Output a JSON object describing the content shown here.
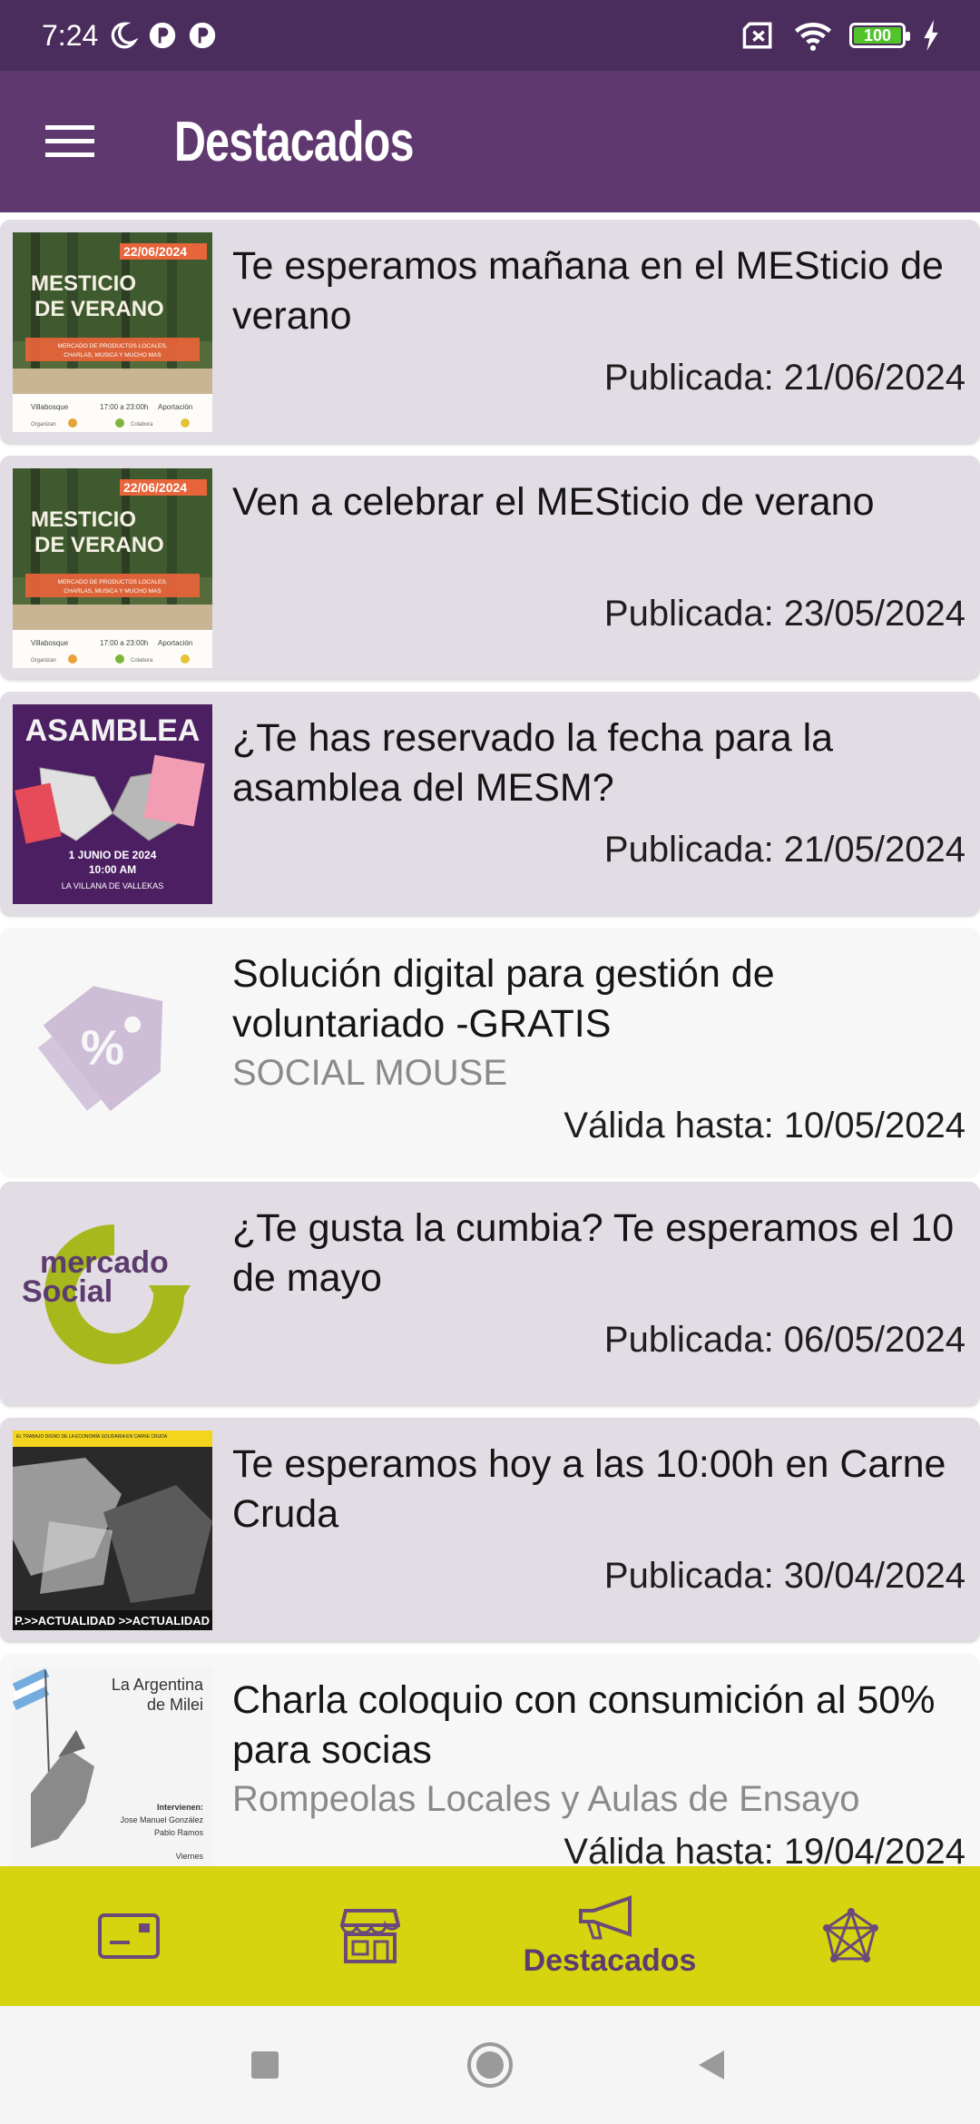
{
  "status_bar": {
    "time": "7:24",
    "battery_level": "100",
    "icons": [
      "moon-icon",
      "notification-icon",
      "notification-icon",
      "sim-off-icon",
      "wifi-icon",
      "battery-icon",
      "charging-icon"
    ]
  },
  "app_bar": {
    "title": "Destacados",
    "menu_icon": "hamburger-menu-icon"
  },
  "items": [
    {
      "kind": "publication",
      "title": "Te esperamos mañana en el MESticio de verano",
      "date_text": "Publicada: 21/06/2024",
      "thumb": {
        "heading1": "MESTICIO",
        "heading2": "DE VERANO",
        "date_tag": "22/06/2024",
        "band_text": "MERCADO DE PRODUCTOS LOCALES, CHARLAS, MUSICA Y MUCHO MAS",
        "place": "Villabosque",
        "hours": "17:00 a 23:00h",
        "fee": "Aportación",
        "footer_left": "Organizan",
        "footer_right": "Colabora"
      }
    },
    {
      "kind": "publication",
      "title": "Ven a celebrar el MESticio de verano",
      "date_text": "Publicada: 23/05/2024",
      "thumb": {
        "heading1": "MESTICIO",
        "heading2": "DE VERANO",
        "date_tag": "22/06/2024",
        "band_text": "MERCADO DE PRODUCTOS LOCALES, CHARLAS, MUSICA Y MUCHO MAS",
        "place": "Villabosque",
        "hours": "17:00 a 23:00h",
        "fee": "Aportación",
        "footer_left": "Organizan",
        "footer_right": "Colabora"
      }
    },
    {
      "kind": "publication",
      "title": "¿Te has reservado la fecha para la asamblea del MESM?",
      "date_text": "Publicada: 21/05/2024",
      "thumb": {
        "heading": "ASAMBLEA",
        "line1": "1 JUNIO DE 2024",
        "line2": "10:00 AM",
        "line3": "LA VILLANA DE VALLEKAS"
      }
    },
    {
      "kind": "offer",
      "title": "Solución digital para gestión de voluntariado -GRATIS",
      "subtitle": "SOCIAL MOUSE",
      "date_text": "Válida hasta: 10/05/2024",
      "thumb_icon": "discount-tag-icon"
    },
    {
      "kind": "publication",
      "title": "¿Te gusta la cumbia? Te esperamos el 10 de mayo",
      "date_text": "Publicada: 06/05/2024",
      "thumb": {
        "logo_word1": "mercado",
        "logo_word2": "Social"
      }
    },
    {
      "kind": "publication",
      "title": "Te esperamos hoy a las 10:00h en Carne Cruda",
      "date_text": "Publicada: 30/04/2024",
      "thumb": {
        "top_text": "EL TRABAJO DIGNO DE LA ECONOMÍA SOLIDARIA EN CARNE CRUDA",
        "bottom_text": "P.>>ACTUALIDAD >>ACTUALIDAD >>A"
      }
    },
    {
      "kind": "offer",
      "title": "Charla coloquio con consumición al 50% para socias",
      "subtitle": "Rompeolas Locales y Aulas de Ensayo",
      "date_text": "Válida hasta: 19/04/2024",
      "thumb": {
        "line1": "La Argentina",
        "line2": "de Milei",
        "speakers_label": "Intervienen:",
        "speaker1": "Jose Manuel González",
        "speaker2": "Pablo Ramos",
        "day": "Viernes"
      }
    }
  ],
  "bottom_nav": {
    "active_label": "Destacados",
    "icons": [
      "card-icon",
      "store-icon",
      "megaphone-icon",
      "network-icon"
    ]
  },
  "colors": {
    "status_bar": "#4a2d5c",
    "app_bar": "#5f386f",
    "card_background": "#e2dce4",
    "bottom_nav": "#d6d40f",
    "nav_icon": "#6b4a7a"
  }
}
